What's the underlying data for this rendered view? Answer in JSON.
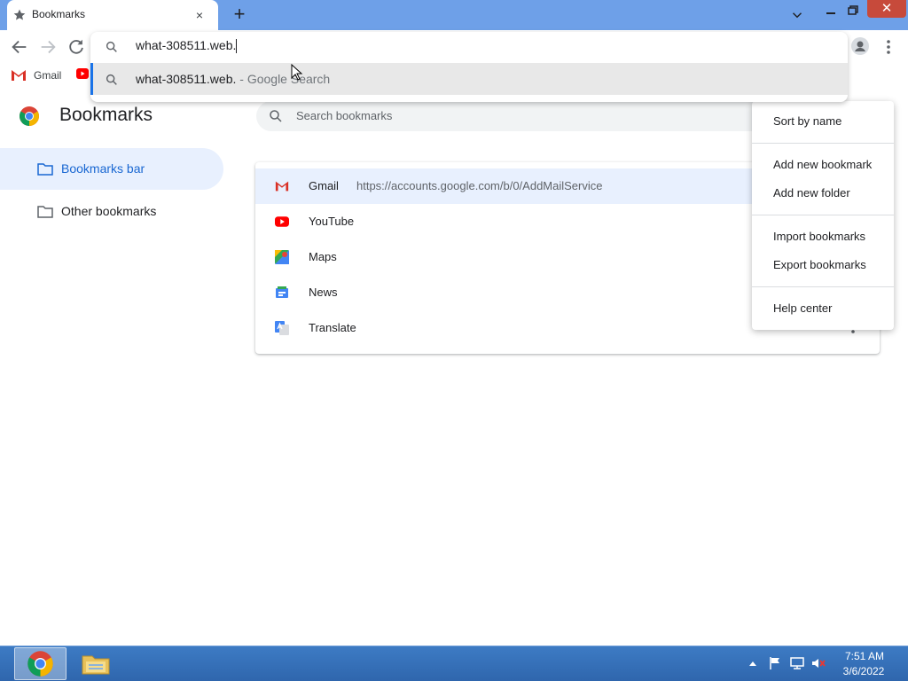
{
  "browser": {
    "tab": {
      "title": "Bookmarks",
      "icon": "star-icon",
      "close_label": "×"
    },
    "new_tab_label": "+",
    "window": {
      "close_label": "✕"
    }
  },
  "omnibox": {
    "input_value": "what-308511.web.",
    "suggestion": {
      "query": "what-308511.web.",
      "suffix": " - Google Search"
    }
  },
  "bookmarks_bar": {
    "items": [
      {
        "label": "Gmail",
        "icon": "gmail-icon"
      },
      {
        "label": "",
        "icon": "youtube-icon"
      }
    ]
  },
  "page": {
    "title": "Bookmarks",
    "search_placeholder": "Search bookmarks"
  },
  "sidebar": {
    "items": [
      {
        "label": "Bookmarks bar",
        "selected": true
      },
      {
        "label": "Other bookmarks",
        "selected": false
      }
    ]
  },
  "list": {
    "rows": [
      {
        "name": "Gmail",
        "url": "https://accounts.google.com/b/0/AddMailService",
        "icon": "gmail-icon",
        "selected": true
      },
      {
        "name": "YouTube",
        "url": "",
        "icon": "youtube-icon",
        "selected": false
      },
      {
        "name": "Maps",
        "url": "",
        "icon": "maps-icon",
        "selected": false
      },
      {
        "name": "News",
        "url": "",
        "icon": "news-icon",
        "selected": false
      },
      {
        "name": "Translate",
        "url": "",
        "icon": "translate-icon",
        "selected": false
      }
    ]
  },
  "context_menu": {
    "items": [
      "Sort by name",
      "Add new bookmark",
      "Add new folder",
      "Import bookmarks",
      "Export bookmarks",
      "Help center"
    ]
  },
  "taskbar": {
    "time": "7:51 AM",
    "date": "3/6/2022"
  },
  "colors": {
    "titlebar": "#6ea0e8",
    "accent": "#1a73e8",
    "selected_bg": "#e8f0fe",
    "taskbar": "#2f66ad"
  }
}
